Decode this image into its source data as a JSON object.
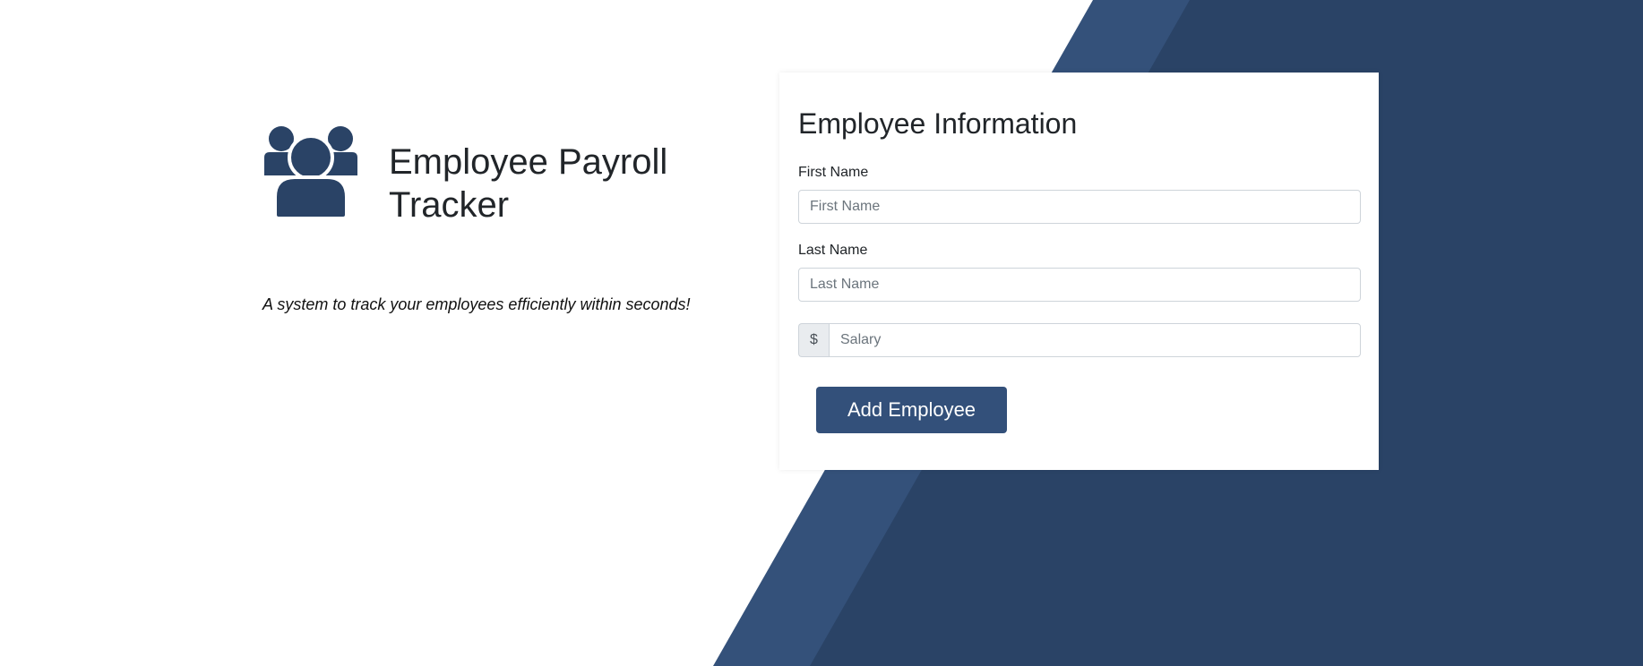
{
  "app": {
    "title": "Employee Payroll Tracker",
    "tagline": "A system to track your employees efficiently within seconds!",
    "logo_icon": "users-group-icon"
  },
  "form": {
    "title": "Employee Information",
    "first_name": {
      "label": "First Name",
      "placeholder": "First Name",
      "value": ""
    },
    "last_name": {
      "label": "Last Name",
      "placeholder": "Last Name",
      "value": ""
    },
    "salary": {
      "prefix": "$",
      "placeholder": "Salary",
      "value": ""
    },
    "submit_label": "Add Employee"
  },
  "colors": {
    "brand_dark": "#2a4366",
    "brand_light": "#34517a",
    "button": "#33507a",
    "background": "#ffffff"
  }
}
